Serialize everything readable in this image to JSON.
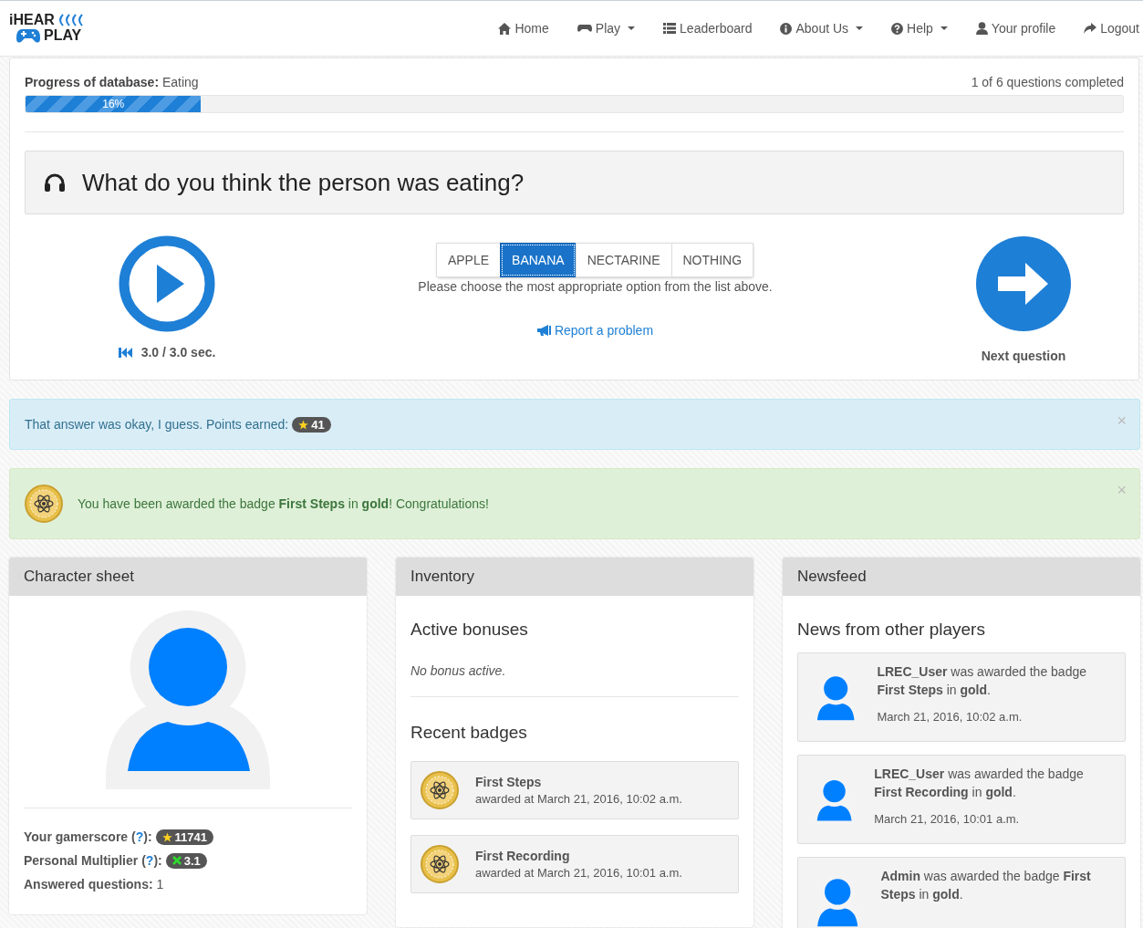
{
  "logo": {
    "line_1": "iHEAR",
    "line_2": "PLAY"
  },
  "nav": [
    {
      "label": "Home",
      "kind": "home",
      "dropdown": false
    },
    {
      "label": "Play",
      "kind": "gamepad",
      "dropdown": true
    },
    {
      "label": "Leaderboard",
      "kind": "list",
      "dropdown": false
    },
    {
      "label": "About Us",
      "kind": "info",
      "dropdown": true
    },
    {
      "label": "Help",
      "kind": "help",
      "dropdown": true
    },
    {
      "label": "Your profile",
      "kind": "user",
      "dropdown": false
    },
    {
      "label": "Logout",
      "kind": "logout",
      "dropdown": false
    }
  ],
  "progress": {
    "label": "Progress of database:",
    "database": "Eating",
    "completed": "1 of 6 questions completed",
    "level": 0.16,
    "reading": "16%"
  },
  "question": "What do you think the person was eating?",
  "options": [
    {
      "label": "APPLE",
      "selected": false
    },
    {
      "label": "BANANA",
      "selected": true
    },
    {
      "label": "NECTARINE",
      "selected": false
    },
    {
      "label": "NOTHING",
      "selected": false
    }
  ],
  "hint": "Please choose the most appropriate option from the list above.",
  "report_link": "Report a problem",
  "timer": "3.0 / 3.0 sec.",
  "next": "Next question",
  "alerts": [
    {
      "kind": "info",
      "text": "That answer was okay, I guess. Points earned:",
      "points": "41",
      "close": "×"
    },
    {
      "kind": "success",
      "text": "You have been awarded the badge **First Steps** in **gold**! Congratulations!",
      "close": "×"
    }
  ],
  "character_sheet": {
    "title": "Character sheet",
    "stats": [
      {
        "kind": "star",
        "label": "Your gamerscore (",
        "help": "?",
        "suffix": "):",
        "value": "11741"
      },
      {
        "kind": "multiplier",
        "label": "Personal Multiplier (",
        "help": "?",
        "suffix": "):",
        "value": "3.1"
      }
    ],
    "answered_label": "Answered questions:",
    "answered_value": "1"
  },
  "inventory": {
    "title": "Inventory",
    "bonuses_heading": "Active bonuses",
    "bonus_text": "No bonus active.",
    "badges_heading": "Recent badges",
    "badges": [
      {
        "name": "First Steps",
        "awarded": "awarded at March 21, 2016, 10:02 a.m."
      },
      {
        "name": "First Recording",
        "awarded": "awarded at March 21, 2016, 10:01 a.m."
      }
    ]
  },
  "newsfeed": {
    "title": "Newsfeed",
    "heading": "News from other players",
    "items": [
      {
        "text": "**LREC_User** was awarded the badge **First Steps** in **gold**.",
        "date": "March 21, 2016, 10:02 a.m."
      },
      {
        "text": "**LREC_User** was awarded the badge **First Recording** in **gold**.",
        "date": "March 21, 2016, 10:01 a.m."
      },
      {
        "text": "**Admin** was awarded the badge **First Steps** in **gold**."
      }
    ]
  }
}
